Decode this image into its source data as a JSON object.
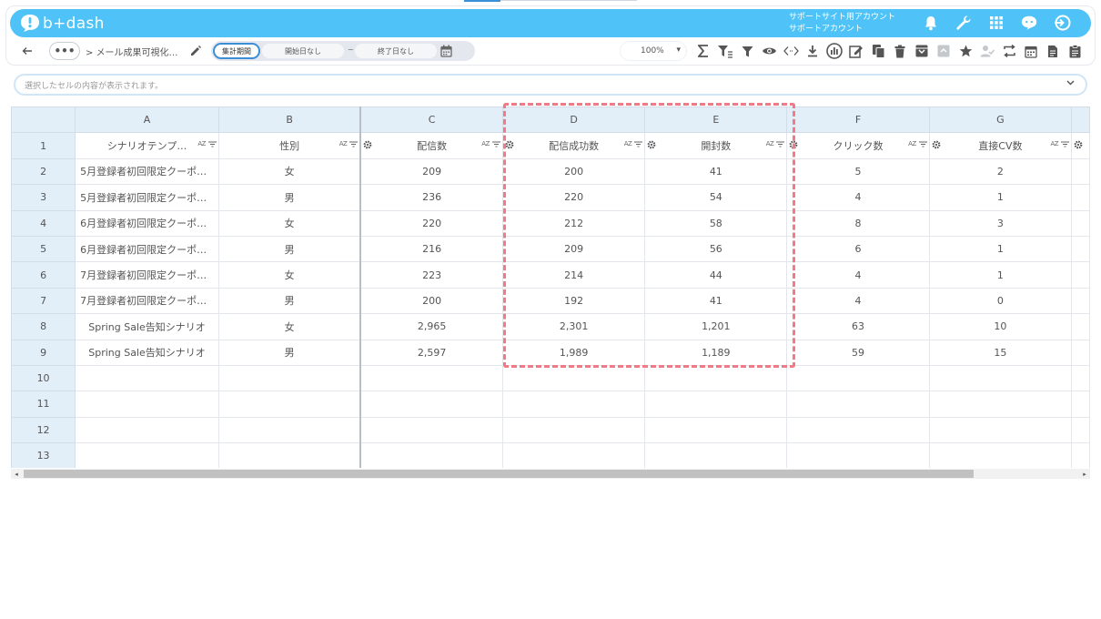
{
  "app": {
    "brand": "b+dash",
    "account_line1": "サポートサイト用アカウント",
    "account_line2": "サポートアカウント"
  },
  "toolbar": {
    "breadcrumb": "> メール成果可視化…",
    "period_label": "集計期間",
    "start_date": "開始日なし",
    "separator": "~",
    "end_date": "終了日なし",
    "zoom": "100%"
  },
  "cellbar": {
    "placeholder": "選択したセルの内容が表示されます。"
  },
  "grid": {
    "columns": [
      "A",
      "B",
      "C",
      "D",
      "E",
      "F",
      "G"
    ],
    "headers": [
      "シナリオテンプ…",
      "性別",
      "配信数",
      "配信成功数",
      "開封数",
      "クリック数",
      "直接CV数"
    ],
    "rows": [
      {
        "n": "2",
        "a": "5月登録者初回限定クーポ…",
        "b": "女",
        "c": "209",
        "d": "200",
        "e": "41",
        "f": "5",
        "g": "2"
      },
      {
        "n": "3",
        "a": "5月登録者初回限定クーポ…",
        "b": "男",
        "c": "236",
        "d": "220",
        "e": "54",
        "f": "4",
        "g": "1"
      },
      {
        "n": "4",
        "a": "6月登録者初回限定クーポ…",
        "b": "女",
        "c": "220",
        "d": "212",
        "e": "58",
        "f": "8",
        "g": "3"
      },
      {
        "n": "5",
        "a": "6月登録者初回限定クーポ…",
        "b": "男",
        "c": "216",
        "d": "209",
        "e": "56",
        "f": "6",
        "g": "1"
      },
      {
        "n": "6",
        "a": "7月登録者初回限定クーポ…",
        "b": "女",
        "c": "223",
        "d": "214",
        "e": "44",
        "f": "4",
        "g": "1"
      },
      {
        "n": "7",
        "a": "7月登録者初回限定クーポ…",
        "b": "男",
        "c": "200",
        "d": "192",
        "e": "41",
        "f": "4",
        "g": "0"
      },
      {
        "n": "8",
        "a": "Spring Sale告知シナリオ",
        "b": "女",
        "c": "2,965",
        "d": "2,301",
        "e": "1,201",
        "f": "63",
        "g": "10"
      },
      {
        "n": "9",
        "a": "Spring Sale告知シナリオ",
        "b": "男",
        "c": "2,597",
        "d": "1,989",
        "e": "1,189",
        "f": "59",
        "g": "15"
      }
    ],
    "empty_rows": [
      "10",
      "11",
      "12",
      "13"
    ],
    "header_row_number": "1"
  }
}
